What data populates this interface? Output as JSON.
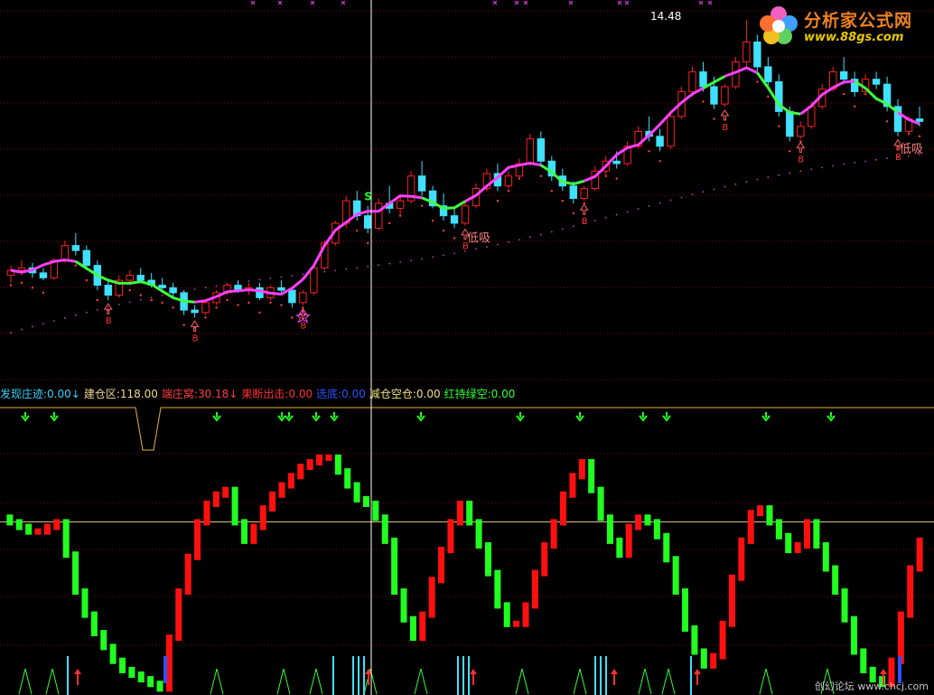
{
  "colors": {
    "background": "#000000",
    "grid": "#8c0000",
    "up": "#ff2020",
    "down": "#40e0ff",
    "trend_up": "#ff40ff",
    "trend_down": "#40ff40",
    "ma_dots": "#ff4040",
    "long_dots": "#c040c0",
    "crosshair": "#ffffff",
    "kdj_up": "#ff1010",
    "kdj_down": "#20ff20"
  },
  "price_panel": {
    "high_label": "14.48",
    "annotations": [
      {
        "text": "低吸",
        "color": "#ff8080",
        "icon": "up-arrow-icon"
      },
      {
        "text": "低吸",
        "color": "#ff8080",
        "icon": "up-arrow-icon"
      }
    ],
    "markers": {
      "buy": "B",
      "sell": "S",
      "star_icon": "star-icon",
      "x_icon": "cross-icon",
      "arrow_up_icon": "up-arrow-icon"
    }
  },
  "indicator_legend": [
    {
      "label": "发现庄迹:",
      "value": "0.00",
      "suffix": "↓",
      "color": "#3ad0ff"
    },
    {
      "label": "建仓区:",
      "value": "118.00",
      "suffix": "",
      "color": "#f0d890"
    },
    {
      "label": "端庄窝:",
      "value": "30.18",
      "suffix": "↓",
      "color": "#ff4040"
    },
    {
      "label": "果断出击:",
      "value": "0.00",
      "suffix": "",
      "color": "#ff3030"
    },
    {
      "label": "选底:",
      "value": "0.00",
      "suffix": "",
      "color": "#3050ff"
    },
    {
      "label": "减仓空仓:",
      "value": "0.00",
      "suffix": "",
      "color": "#f0e080"
    },
    {
      "label": "红持绿空:",
      "value": "0.00",
      "suffix": "",
      "color": "#30ff30"
    }
  ],
  "logo": {
    "title": "分析家公式网",
    "url": "www.88gs.com",
    "icon": "flower-logo-icon"
  },
  "watermark": "创幻论坛 www.chcj.com",
  "chart_data": [
    {
      "type": "candlestick",
      "title": "",
      "max_label": "14.48",
      "ohlc": [
        [
          4.2,
          4.6,
          3.9,
          4.4
        ],
        [
          4.4,
          4.8,
          4.2,
          4.5
        ],
        [
          4.5,
          4.7,
          4.1,
          4.3
        ],
        [
          4.3,
          4.5,
          4.0,
          4.1
        ],
        [
          4.1,
          4.9,
          4.0,
          4.8
        ],
        [
          4.8,
          5.6,
          4.7,
          5.4
        ],
        [
          5.4,
          5.9,
          5.0,
          5.2
        ],
        [
          5.2,
          5.4,
          4.4,
          4.6
        ],
        [
          4.6,
          4.8,
          3.6,
          3.8
        ],
        [
          3.8,
          4.0,
          3.2,
          3.4
        ],
        [
          3.4,
          4.2,
          3.3,
          4.0
        ],
        [
          4.0,
          4.4,
          3.8,
          4.2
        ],
        [
          4.2,
          4.5,
          3.9,
          4.0
        ],
        [
          4.0,
          4.3,
          3.7,
          3.8
        ],
        [
          3.8,
          4.1,
          3.5,
          3.7
        ],
        [
          3.7,
          3.9,
          3.3,
          3.5
        ],
        [
          3.5,
          3.6,
          2.6,
          2.8
        ],
        [
          2.8,
          3.0,
          2.5,
          2.7
        ],
        [
          2.7,
          3.2,
          2.6,
          3.1
        ],
        [
          3.1,
          3.6,
          3.0,
          3.5
        ],
        [
          3.5,
          3.9,
          3.4,
          3.8
        ],
        [
          3.8,
          4.0,
          3.5,
          3.6
        ],
        [
          3.6,
          3.9,
          3.4,
          3.7
        ],
        [
          3.7,
          3.9,
          3.2,
          3.3
        ],
        [
          3.3,
          3.8,
          3.2,
          3.7
        ],
        [
          3.7,
          4.0,
          3.5,
          3.6
        ],
        [
          3.6,
          3.7,
          2.9,
          3.1
        ],
        [
          3.1,
          3.6,
          3.0,
          3.5
        ],
        [
          3.5,
          4.6,
          3.4,
          4.5
        ],
        [
          4.5,
          5.6,
          4.4,
          5.5
        ],
        [
          5.5,
          6.4,
          5.4,
          6.3
        ],
        [
          6.3,
          7.4,
          6.1,
          7.2
        ],
        [
          7.2,
          7.6,
          6.4,
          6.6
        ],
        [
          6.6,
          7.0,
          5.9,
          6.1
        ],
        [
          6.1,
          7.3,
          6.0,
          7.1
        ],
        [
          7.1,
          7.8,
          6.7,
          6.9
        ],
        [
          6.9,
          7.4,
          6.6,
          7.2
        ],
        [
          7.2,
          8.4,
          7.1,
          8.2
        ],
        [
          8.2,
          8.8,
          7.4,
          7.6
        ],
        [
          7.6,
          7.8,
          6.9,
          7.0
        ],
        [
          7.0,
          7.5,
          6.4,
          6.6
        ],
        [
          6.6,
          6.9,
          6.1,
          6.3
        ],
        [
          6.3,
          7.2,
          6.2,
          7.0
        ],
        [
          7.0,
          7.9,
          6.9,
          7.7
        ],
        [
          7.7,
          8.5,
          7.6,
          8.3
        ],
        [
          8.3,
          8.7,
          7.6,
          7.8
        ],
        [
          7.8,
          8.4,
          7.7,
          8.2
        ],
        [
          8.2,
          8.9,
          8.1,
          8.7
        ],
        [
          8.7,
          9.9,
          8.6,
          9.7
        ],
        [
          9.7,
          10.0,
          8.6,
          8.8
        ],
        [
          8.8,
          9.0,
          8.0,
          8.2
        ],
        [
          8.2,
          8.5,
          7.6,
          7.8
        ],
        [
          7.8,
          8.0,
          7.1,
          7.3
        ],
        [
          7.3,
          7.8,
          7.2,
          7.7
        ],
        [
          7.7,
          8.6,
          7.6,
          8.4
        ],
        [
          8.4,
          9.0,
          8.2,
          8.8
        ],
        [
          8.8,
          9.2,
          8.5,
          8.7
        ],
        [
          8.7,
          9.6,
          8.6,
          9.4
        ],
        [
          9.4,
          10.2,
          9.3,
          10.0
        ],
        [
          10.0,
          10.6,
          9.6,
          9.8
        ],
        [
          9.8,
          10.1,
          9.2,
          9.4
        ],
        [
          9.4,
          10.8,
          9.3,
          10.6
        ],
        [
          10.6,
          11.8,
          10.5,
          11.6
        ],
        [
          11.6,
          12.6,
          11.4,
          12.4
        ],
        [
          12.4,
          12.8,
          11.6,
          11.8
        ],
        [
          11.8,
          12.2,
          10.9,
          11.1
        ],
        [
          11.1,
          11.9,
          11.0,
          11.8
        ],
        [
          11.8,
          13.0,
          11.7,
          12.8
        ],
        [
          12.8,
          14.48,
          12.6,
          13.6
        ],
        [
          13.6,
          13.9,
          12.4,
          12.6
        ],
        [
          12.6,
          13.0,
          11.8,
          12.0
        ],
        [
          12.0,
          12.3,
          10.6,
          10.8
        ],
        [
          10.8,
          11.0,
          9.6,
          9.8
        ],
        [
          9.8,
          10.4,
          9.7,
          10.2
        ],
        [
          10.2,
          11.2,
          10.1,
          11.0
        ],
        [
          11.0,
          11.9,
          10.9,
          11.7
        ],
        [
          11.7,
          12.6,
          11.6,
          12.4
        ],
        [
          12.4,
          13.0,
          11.9,
          12.1
        ],
        [
          12.1,
          12.4,
          11.4,
          11.6
        ],
        [
          11.6,
          12.3,
          11.5,
          12.1
        ],
        [
          12.1,
          12.4,
          11.7,
          11.9
        ],
        [
          11.9,
          12.2,
          10.8,
          11.0
        ],
        [
          11.0,
          11.3,
          9.8,
          10.0
        ],
        [
          10.0,
          10.6,
          9.9,
          10.5
        ],
        [
          10.5,
          11.0,
          10.2,
          10.4
        ]
      ],
      "trend_segments": [
        {
          "from": 0,
          "to": 6,
          "state": "up"
        },
        {
          "from": 6,
          "to": 17,
          "state": "down"
        },
        {
          "from": 17,
          "to": 27,
          "state": "up"
        },
        {
          "from": 27,
          "to": 38,
          "state": "up"
        },
        {
          "from": 38,
          "to": 42,
          "state": "down"
        },
        {
          "from": 42,
          "to": 49,
          "state": "up"
        },
        {
          "from": 49,
          "to": 53,
          "state": "down"
        },
        {
          "from": 53,
          "to": 64,
          "state": "up"
        },
        {
          "from": 64,
          "to": 66,
          "state": "down"
        },
        {
          "from": 66,
          "to": 69,
          "state": "up"
        },
        {
          "from": 69,
          "to": 73,
          "state": "down"
        },
        {
          "from": 73,
          "to": 78,
          "state": "up"
        },
        {
          "from": 78,
          "to": 82,
          "state": "down"
        },
        {
          "from": 82,
          "to": 85,
          "state": "up"
        }
      ],
      "ylim": [
        0,
        15.0
      ]
    },
    {
      "type": "line",
      "title": "",
      "series": [
        {
          "values": [
            72,
            70,
            68,
            66,
            66,
            68,
            70,
            56,
            40,
            30,
            22,
            16,
            10,
            6,
            4,
            2,
            0,
            -2,
            20,
            40,
            55,
            70,
            78,
            82,
            84,
            70,
            62,
            68,
            76,
            82,
            86,
            90,
            94,
            96,
            98,
            98,
            92,
            86,
            80,
            78,
            72,
            62,
            40,
            28,
            20,
            30,
            45,
            58,
            70,
            78,
            70,
            60,
            48,
            34,
            26,
            26,
            34,
            48,
            60,
            70,
            82,
            90,
            96,
            84,
            72,
            62,
            56,
            68,
            72,
            70,
            64,
            54,
            40,
            24,
            14,
            8,
            12,
            26,
            46,
            62,
            74,
            76,
            70,
            64,
            58,
            60,
            70,
            60,
            50,
            40,
            28,
            14,
            6,
            2,
            0,
            10,
            30,
            50,
            62
          ]
        }
      ],
      "ylim": [
        -5,
        105
      ],
      "reference_line": 70
    }
  ]
}
